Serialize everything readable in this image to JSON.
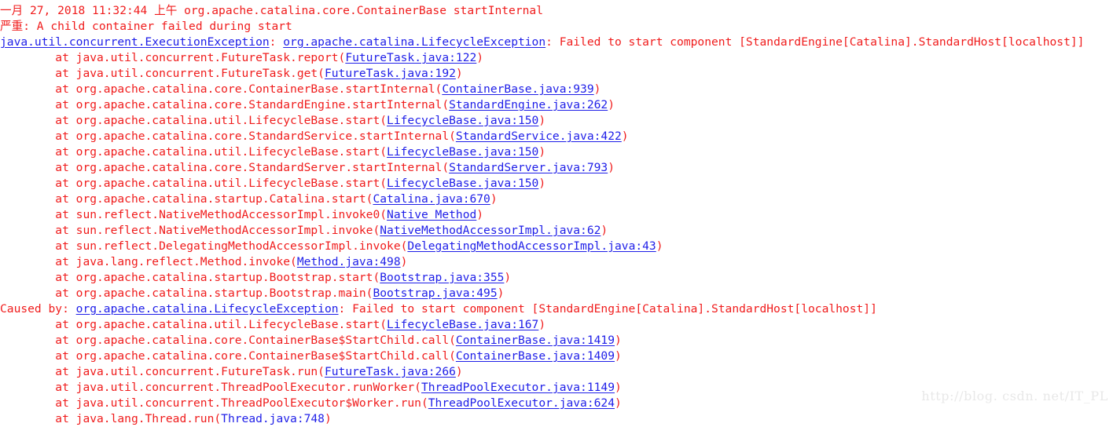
{
  "console": {
    "background_color": "#ffffff",
    "text_color": "#f01c1c",
    "link_color": "#1e1ee8",
    "watermark": "http://blog. csdn. net/IT_PL",
    "lines": [
      {
        "indent": 0,
        "segments": [
          {
            "kind": "text",
            "text": "一月 27, 2018 11:32:44 上午 org.apache.catalina.core.ContainerBase startInternal"
          }
        ]
      },
      {
        "indent": 0,
        "segments": [
          {
            "kind": "text",
            "text": "严重: A child container failed during start"
          }
        ]
      },
      {
        "indent": 0,
        "segments": [
          {
            "kind": "link",
            "text": "java.util.concurrent.ExecutionException"
          },
          {
            "kind": "text",
            "text": ": "
          },
          {
            "kind": "link",
            "text": "org.apache.catalina.LifecycleException"
          },
          {
            "kind": "text",
            "text": ": Failed to start component [StandardEngine[Catalina].StandardHost[localhost]]"
          }
        ]
      },
      {
        "indent": 8,
        "segments": [
          {
            "kind": "text",
            "text": "at java.util.concurrent.FutureTask.report("
          },
          {
            "kind": "link",
            "text": "FutureTask.java:122"
          },
          {
            "kind": "text",
            "text": ")"
          }
        ]
      },
      {
        "indent": 8,
        "segments": [
          {
            "kind": "text",
            "text": "at java.util.concurrent.FutureTask.get("
          },
          {
            "kind": "link",
            "text": "FutureTask.java:192"
          },
          {
            "kind": "text",
            "text": ")"
          }
        ]
      },
      {
        "indent": 8,
        "segments": [
          {
            "kind": "text",
            "text": "at org.apache.catalina.core.ContainerBase.startInternal("
          },
          {
            "kind": "link",
            "text": "ContainerBase.java:939"
          },
          {
            "kind": "text",
            "text": ")"
          }
        ]
      },
      {
        "indent": 8,
        "segments": [
          {
            "kind": "text",
            "text": "at org.apache.catalina.core.StandardEngine.startInternal("
          },
          {
            "kind": "link",
            "text": "StandardEngine.java:262"
          },
          {
            "kind": "text",
            "text": ")"
          }
        ]
      },
      {
        "indent": 8,
        "segments": [
          {
            "kind": "text",
            "text": "at org.apache.catalina.util.LifecycleBase.start("
          },
          {
            "kind": "link",
            "text": "LifecycleBase.java:150"
          },
          {
            "kind": "text",
            "text": ")"
          }
        ]
      },
      {
        "indent": 8,
        "segments": [
          {
            "kind": "text",
            "text": "at org.apache.catalina.core.StandardService.startInternal("
          },
          {
            "kind": "link",
            "text": "StandardService.java:422"
          },
          {
            "kind": "text",
            "text": ")"
          }
        ]
      },
      {
        "indent": 8,
        "segments": [
          {
            "kind": "text",
            "text": "at org.apache.catalina.util.LifecycleBase.start("
          },
          {
            "kind": "link",
            "text": "LifecycleBase.java:150"
          },
          {
            "kind": "text",
            "text": ")"
          }
        ]
      },
      {
        "indent": 8,
        "segments": [
          {
            "kind": "text",
            "text": "at org.apache.catalina.core.StandardServer.startInternal("
          },
          {
            "kind": "link",
            "text": "StandardServer.java:793"
          },
          {
            "kind": "text",
            "text": ")"
          }
        ]
      },
      {
        "indent": 8,
        "segments": [
          {
            "kind": "text",
            "text": "at org.apache.catalina.util.LifecycleBase.start("
          },
          {
            "kind": "link",
            "text": "LifecycleBase.java:150"
          },
          {
            "kind": "text",
            "text": ")"
          }
        ]
      },
      {
        "indent": 8,
        "segments": [
          {
            "kind": "text",
            "text": "at org.apache.catalina.startup.Catalina.start("
          },
          {
            "kind": "link",
            "text": "Catalina.java:670"
          },
          {
            "kind": "text",
            "text": ")"
          }
        ]
      },
      {
        "indent": 8,
        "segments": [
          {
            "kind": "text",
            "text": "at sun.reflect.NativeMethodAccessorImpl.invoke0("
          },
          {
            "kind": "link",
            "text": "Native Method"
          },
          {
            "kind": "text",
            "text": ")"
          }
        ]
      },
      {
        "indent": 8,
        "segments": [
          {
            "kind": "text",
            "text": "at sun.reflect.NativeMethodAccessorImpl.invoke("
          },
          {
            "kind": "link",
            "text": "NativeMethodAccessorImpl.java:62"
          },
          {
            "kind": "text",
            "text": ")"
          }
        ]
      },
      {
        "indent": 8,
        "segments": [
          {
            "kind": "text",
            "text": "at sun.reflect.DelegatingMethodAccessorImpl.invoke("
          },
          {
            "kind": "link",
            "text": "DelegatingMethodAccessorImpl.java:43"
          },
          {
            "kind": "text",
            "text": ")"
          }
        ]
      },
      {
        "indent": 8,
        "segments": [
          {
            "kind": "text",
            "text": "at java.lang.reflect.Method.invoke("
          },
          {
            "kind": "link",
            "text": "Method.java:498"
          },
          {
            "kind": "text",
            "text": ")"
          }
        ]
      },
      {
        "indent": 8,
        "segments": [
          {
            "kind": "text",
            "text": "at org.apache.catalina.startup.Bootstrap.start("
          },
          {
            "kind": "link",
            "text": "Bootstrap.java:355"
          },
          {
            "kind": "text",
            "text": ")"
          }
        ]
      },
      {
        "indent": 8,
        "segments": [
          {
            "kind": "text",
            "text": "at org.apache.catalina.startup.Bootstrap.main("
          },
          {
            "kind": "link",
            "text": "Bootstrap.java:495"
          },
          {
            "kind": "text",
            "text": ")"
          }
        ]
      },
      {
        "indent": 0,
        "segments": [
          {
            "kind": "text",
            "text": "Caused by: "
          },
          {
            "kind": "link",
            "text": "org.apache.catalina.LifecycleException"
          },
          {
            "kind": "text",
            "text": ": Failed to start component [StandardEngine[Catalina].StandardHost[localhost]]"
          }
        ]
      },
      {
        "indent": 8,
        "segments": [
          {
            "kind": "text",
            "text": "at org.apache.catalina.util.LifecycleBase.start("
          },
          {
            "kind": "link",
            "text": "LifecycleBase.java:167"
          },
          {
            "kind": "text",
            "text": ")"
          }
        ]
      },
      {
        "indent": 8,
        "segments": [
          {
            "kind": "text",
            "text": "at org.apache.catalina.core.ContainerBase$StartChild.call("
          },
          {
            "kind": "link",
            "text": "ContainerBase.java:1419"
          },
          {
            "kind": "text",
            "text": ")"
          }
        ]
      },
      {
        "indent": 8,
        "segments": [
          {
            "kind": "text",
            "text": "at org.apache.catalina.core.ContainerBase$StartChild.call("
          },
          {
            "kind": "link",
            "text": "ContainerBase.java:1409"
          },
          {
            "kind": "text",
            "text": ")"
          }
        ]
      },
      {
        "indent": 8,
        "segments": [
          {
            "kind": "text",
            "text": "at java.util.concurrent.FutureTask.run("
          },
          {
            "kind": "link",
            "text": "FutureTask.java:266"
          },
          {
            "kind": "text",
            "text": ")"
          }
        ]
      },
      {
        "indent": 8,
        "segments": [
          {
            "kind": "text",
            "text": "at java.util.concurrent.ThreadPoolExecutor.runWorker("
          },
          {
            "kind": "link",
            "text": "ThreadPoolExecutor.java:1149"
          },
          {
            "kind": "text",
            "text": ")"
          }
        ]
      },
      {
        "indent": 8,
        "segments": [
          {
            "kind": "text",
            "text": "at java.util.concurrent.ThreadPoolExecutor$Worker.run("
          },
          {
            "kind": "link",
            "text": "ThreadPoolExecutor.java:624"
          },
          {
            "kind": "text",
            "text": ")"
          }
        ]
      },
      {
        "indent": 8,
        "segments": [
          {
            "kind": "text",
            "text": "at java.lang.Thread.run("
          },
          {
            "kind": "link",
            "text": "Thread.java:748",
            "underline": false
          },
          {
            "kind": "text",
            "text": ")"
          }
        ]
      }
    ]
  }
}
